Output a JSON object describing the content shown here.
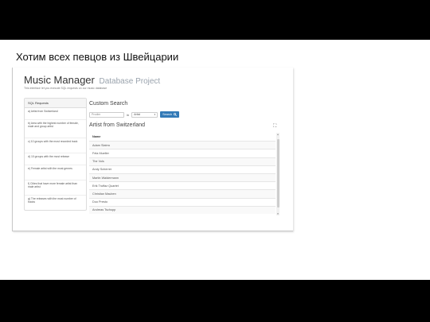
{
  "slide": {
    "title": "Хотим всех певцов из Швейцарии"
  },
  "app": {
    "title": "Music Manager",
    "subtitle": "Database Project",
    "intro": "This interface let you execute SQL requests on our music database"
  },
  "sidebar": {
    "heading": "SQL Requests",
    "items": [
      {
        "label": "a) Artist from Switzerland"
      },
      {
        "label": "b) Area with the highest number of female, male and group artist"
      },
      {
        "label": "c) 10 groups with the most recorded track"
      },
      {
        "label": "d) 10 groups with the most release"
      },
      {
        "label": "e) Female artist with the most genres"
      },
      {
        "label": "f) Cities that have more female artist than male artist"
      },
      {
        "label": "g) The releases with the most number of tracks"
      }
    ]
  },
  "search": {
    "title": "Custom Search",
    "input_value": "Prodier",
    "in_label": "in",
    "select_value": "Artist",
    "button_label": "Search"
  },
  "results": {
    "title": "Artist from Switzerland",
    "column": "Name",
    "rows": [
      "Adam Slatrro",
      "Fela Mueller",
      "The Vols",
      "Andy Scherrer",
      "Martin Waldermann",
      "Erik Truffaz Quartet",
      "Christian Mauben",
      "Duo Presto",
      "Andreas Tschopp"
    ]
  }
}
